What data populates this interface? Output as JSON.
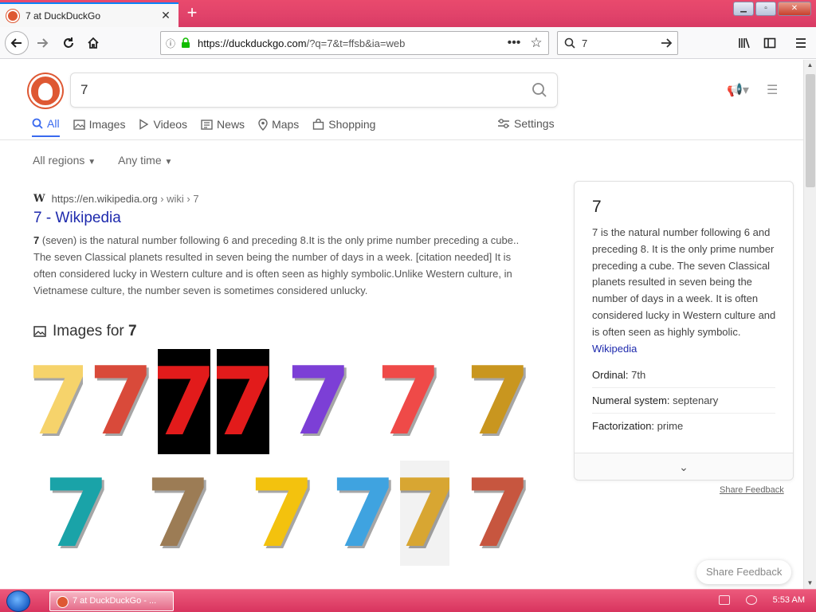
{
  "browser": {
    "tab_title": "7 at DuckDuckGo",
    "url_host": "https://duckduckgo.com",
    "url_path": "/?q=7&t=ffsb&ia=web",
    "search_value": "7"
  },
  "ddg": {
    "query": "7",
    "tabs": [
      "All",
      "Images",
      "Videos",
      "News",
      "Maps",
      "Shopping"
    ],
    "settings_label": "Settings",
    "filters": [
      "All regions",
      "Any time"
    ]
  },
  "result": {
    "url_host": "https://en.wikipedia.org",
    "url_path": "› wiki › 7",
    "title": "7 - Wikipedia",
    "snippet_bold": "7",
    "snippet": "(seven) is the natural number following 6 and preceding 8.It is the only prime number preceding a cube.. The seven Classical planets resulted in seven being the number of days in a week. [citation needed] It is often considered lucky in Western culture and is often seen as highly symbolic.Unlike Western culture, in Vietnamese culture, the number seven is sometimes considered unlucky."
  },
  "images_section": {
    "label": "Images for",
    "term": "7",
    "images": [
      {
        "glyph": "7",
        "color": "#f6d36b",
        "bg": "#ffffff"
      },
      {
        "glyph": "7",
        "color": "#d94a3a",
        "bg": "#ffffff"
      },
      {
        "glyph": "7",
        "color": "#e21b1b",
        "bg": "#000000"
      },
      {
        "glyph": "7",
        "color": "#e21b1b",
        "bg": "#000000"
      },
      {
        "glyph": "7",
        "color": "#7c3fd6",
        "bg": "#ffffff"
      },
      {
        "glyph": "7",
        "color": "#ef4a48",
        "bg": "#ffffff"
      },
      {
        "glyph": "7",
        "color": "#c9961f",
        "bg": "#ffffff"
      },
      {
        "glyph": "7",
        "color": "#1aa3a8",
        "bg": "#ffffff"
      },
      {
        "glyph": "7",
        "color": "#9c7c55",
        "bg": "#ffffff"
      },
      {
        "glyph": "7",
        "color": "#f3c20e",
        "bg": "#ffffff"
      },
      {
        "glyph": "7",
        "color": "#3fa3e0",
        "bg": "#ffffff"
      },
      {
        "glyph": "7",
        "color": "#d8a632",
        "bg": "#f2f2f2"
      },
      {
        "glyph": "7",
        "color": "#c7563f",
        "bg": "#ffffff"
      }
    ]
  },
  "panel": {
    "title": "7",
    "description": "7 is the natural number following 6 and preceding 8. It is the only prime number preceding a cube. The seven Classical planets resulted in seven being the number of days in a week. It is often considered lucky in Western culture and is often seen as highly symbolic.",
    "source_link": "Wikipedia",
    "facts": [
      {
        "label": "Ordinal:",
        "value": "7th"
      },
      {
        "label": "Numeral system:",
        "value": "septenary"
      },
      {
        "label": "Factorization:",
        "value": "prime"
      }
    ],
    "share_feedback": "Share Feedback"
  },
  "floating_feedback": "Share Feedback",
  "taskbar": {
    "item": "7 at DuckDuckGo - ...",
    "time": "5:53 AM"
  },
  "colors": {
    "accent": "#3969ef",
    "link": "#1e2aad",
    "ddg_orange": "#de5833",
    "titlebar": "#e0426a"
  }
}
